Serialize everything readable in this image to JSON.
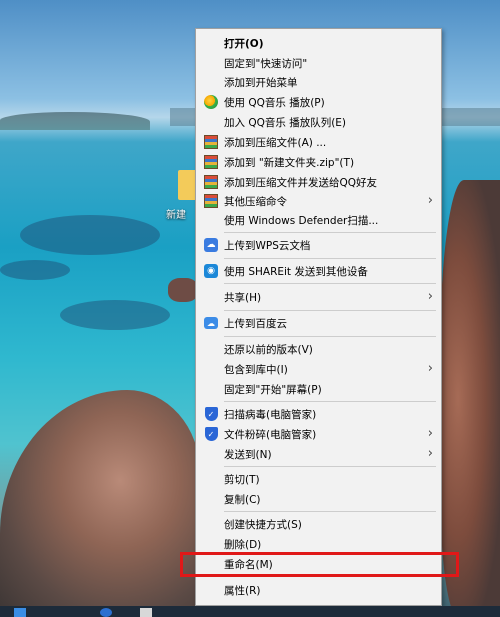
{
  "desktop": {
    "folder_label": "新建"
  },
  "context_menu": {
    "items": [
      {
        "label": "打开(O)"
      },
      {
        "label": "固定到\"快速访问\""
      },
      {
        "label": "添加到开始菜单"
      },
      {
        "label": "使用 QQ音乐 播放(P)",
        "icon": "qq-music-icon"
      },
      {
        "label": "加入 QQ音乐 播放队列(E)"
      },
      {
        "label": "添加到压缩文件(A) ...",
        "icon": "winrar-icon"
      },
      {
        "label": "添加到 \"新建文件夹.zip\"(T)",
        "icon": "winrar-icon"
      },
      {
        "label": "添加到压缩文件并发送给QQ好友",
        "icon": "winrar-icon"
      },
      {
        "label": "其他压缩命令",
        "icon": "winrar-icon"
      },
      {
        "label": "使用 Windows Defender扫描..."
      },
      {
        "label": "上传到WPS云文档",
        "icon": "wps-cloud-icon"
      },
      {
        "label": "使用 SHAREit 发送到其他设备",
        "icon": "shareit-icon"
      },
      {
        "label": "共享(H)"
      },
      {
        "label": "上传到百度云",
        "icon": "baidu-cloud-icon"
      },
      {
        "label": "还原以前的版本(V)"
      },
      {
        "label": "包含到库中(I)"
      },
      {
        "label": "固定到\"开始\"屏幕(P)"
      },
      {
        "label": "扫描病毒(电脑管家)",
        "icon": "tencent-shield-icon"
      },
      {
        "label": "文件粉碎(电脑管家)",
        "icon": "tencent-shield-icon"
      },
      {
        "label": "发送到(N)"
      },
      {
        "label": "剪切(T)"
      },
      {
        "label": "复制(C)"
      },
      {
        "label": "创建快捷方式(S)"
      },
      {
        "label": "删除(D)"
      },
      {
        "label": "重命名(M)"
      },
      {
        "label": "属性(R)"
      }
    ],
    "highlight_color": "#e01818"
  }
}
